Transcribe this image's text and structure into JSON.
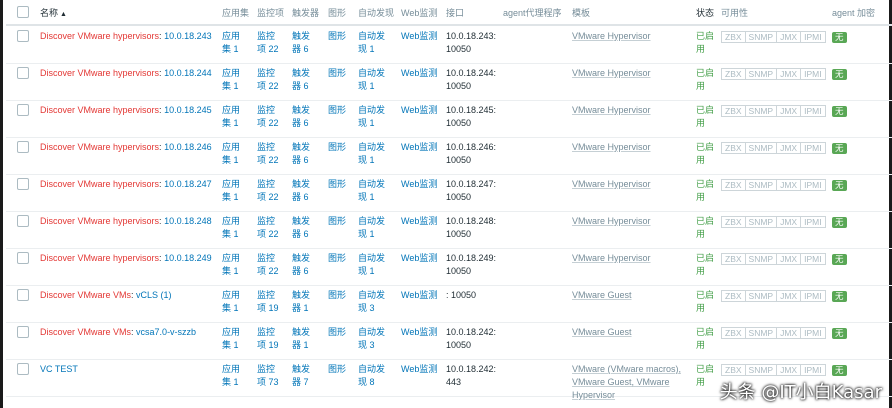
{
  "headers": {
    "name": "名称",
    "applications": "应用集",
    "items": "监控项",
    "triggers": "触发器",
    "graphs": "图形",
    "discovery": "自动发现",
    "web": "Web监测",
    "interface": "接口",
    "agent_proxy": "agent代理程序",
    "templates": "模板",
    "status": "状态",
    "availability": "可用性",
    "agent_encryption": "agent 加密"
  },
  "availability_labels": [
    "ZBX",
    "SNMP",
    "JMX",
    "IPMI"
  ],
  "encryption_label": "无",
  "rows": [
    {
      "prefix": "Discover VMware hypervisors",
      "sep": ":",
      "name": "10.0.18.243",
      "app": [
        "应用",
        "集 1"
      ],
      "items": [
        "监控",
        "项 22"
      ],
      "triggers": [
        "触发",
        "器 6"
      ],
      "graphs": "图形",
      "discovery": [
        "自动发",
        "现 1"
      ],
      "web": "Web监测",
      "iface": [
        "10.0.18.243:",
        "10050"
      ],
      "template": [
        "VMware Hypervisor",
        ""
      ],
      "status": [
        "已启",
        "用"
      ]
    },
    {
      "prefix": "Discover VMware hypervisors",
      "sep": ":",
      "name": "10.0.18.244",
      "app": [
        "应用",
        "集 1"
      ],
      "items": [
        "监控",
        "项 22"
      ],
      "triggers": [
        "触发",
        "器 6"
      ],
      "graphs": "图形",
      "discovery": [
        "自动发",
        "现 1"
      ],
      "web": "Web监测",
      "iface": [
        "10.0.18.244:",
        "10050"
      ],
      "template": [
        "VMware Hypervisor",
        ""
      ],
      "status": [
        "已启",
        "用"
      ]
    },
    {
      "prefix": "Discover VMware hypervisors",
      "sep": ":",
      "name": "10.0.18.245",
      "app": [
        "应用",
        "集 1"
      ],
      "items": [
        "监控",
        "项 22"
      ],
      "triggers": [
        "触发",
        "器 6"
      ],
      "graphs": "图形",
      "discovery": [
        "自动发",
        "现 1"
      ],
      "web": "Web监测",
      "iface": [
        "10.0.18.245:",
        "10050"
      ],
      "template": [
        "VMware Hypervisor",
        ""
      ],
      "status": [
        "已启",
        "用"
      ]
    },
    {
      "prefix": "Discover VMware hypervisors",
      "sep": ":",
      "name": "10.0.18.246",
      "app": [
        "应用",
        "集 1"
      ],
      "items": [
        "监控",
        "项 22"
      ],
      "triggers": [
        "触发",
        "器 6"
      ],
      "graphs": "图形",
      "discovery": [
        "自动发",
        "现 1"
      ],
      "web": "Web监测",
      "iface": [
        "10.0.18.246:",
        "10050"
      ],
      "template": [
        "VMware Hypervisor",
        ""
      ],
      "status": [
        "已启",
        "用"
      ]
    },
    {
      "prefix": "Discover VMware hypervisors",
      "sep": ":",
      "name": "10.0.18.247",
      "app": [
        "应用",
        "集 1"
      ],
      "items": [
        "监控",
        "项 22"
      ],
      "triggers": [
        "触发",
        "器 6"
      ],
      "graphs": "图形",
      "discovery": [
        "自动发",
        "现 1"
      ],
      "web": "Web监测",
      "iface": [
        "10.0.18.247:",
        "10050"
      ],
      "template": [
        "VMware Hypervisor",
        ""
      ],
      "status": [
        "已启",
        "用"
      ]
    },
    {
      "prefix": "Discover VMware hypervisors",
      "sep": ":",
      "name": "10.0.18.248",
      "app": [
        "应用",
        "集 1"
      ],
      "items": [
        "监控",
        "项 22"
      ],
      "triggers": [
        "触发",
        "器 6"
      ],
      "graphs": "图形",
      "discovery": [
        "自动发",
        "现 1"
      ],
      "web": "Web监测",
      "iface": [
        "10.0.18.248:",
        "10050"
      ],
      "template": [
        "VMware Hypervisor",
        ""
      ],
      "status": [
        "已启",
        "用"
      ]
    },
    {
      "prefix": "Discover VMware hypervisors",
      "sep": ":",
      "name": "10.0.18.249",
      "app": [
        "应用",
        "集 1"
      ],
      "items": [
        "监控",
        "项 22"
      ],
      "triggers": [
        "触发",
        "器 6"
      ],
      "graphs": "图形",
      "discovery": [
        "自动发",
        "现 1"
      ],
      "web": "Web监测",
      "iface": [
        "10.0.18.249:",
        "10050"
      ],
      "template": [
        "VMware Hypervisor",
        ""
      ],
      "status": [
        "已启",
        "用"
      ]
    },
    {
      "prefix": "Discover VMware VMs",
      "sep": ":",
      "name": "vCLS (1)",
      "app": [
        "应用",
        "集 1"
      ],
      "items": [
        "监控",
        "项 19"
      ],
      "triggers": [
        "触发",
        "器 1"
      ],
      "graphs": "图形",
      "discovery": [
        "自动发",
        "现 3"
      ],
      "web": "Web监测",
      "iface": [
        ": 10050",
        ""
      ],
      "template": [
        "VMware Guest",
        ""
      ],
      "status": [
        "已启",
        "用"
      ]
    },
    {
      "prefix": "Discover VMware VMs",
      "sep": ":",
      "name": "vcsa7.0-v-szzb",
      "app": [
        "应用",
        "集 1"
      ],
      "items": [
        "监控",
        "项 19"
      ],
      "triggers": [
        "触发",
        "器 1"
      ],
      "graphs": "图形",
      "discovery": [
        "自动发",
        "现 3"
      ],
      "web": "Web监测",
      "iface": [
        "10.0.18.242:",
        "10050"
      ],
      "template": [
        "VMware Guest",
        ""
      ],
      "status": [
        "已启",
        "用"
      ]
    },
    {
      "prefix": "",
      "sep": "",
      "name": "VC TEST",
      "app": [
        "应用",
        "集 1"
      ],
      "items": [
        "监控",
        "项 73"
      ],
      "triggers": [
        "触发",
        "器 7"
      ],
      "graphs": "图形",
      "discovery": [
        "自动发",
        "现 8"
      ],
      "web": "Web监测",
      "iface": [
        "10.0.18.242:",
        "443"
      ],
      "template": [
        "VMware (VMware macros),",
        "VMware Guest, VMware",
        "Hypervisor"
      ],
      "status": [
        "已启",
        "用"
      ]
    }
  ],
  "watermark": "头条 @IT小白Kasar"
}
